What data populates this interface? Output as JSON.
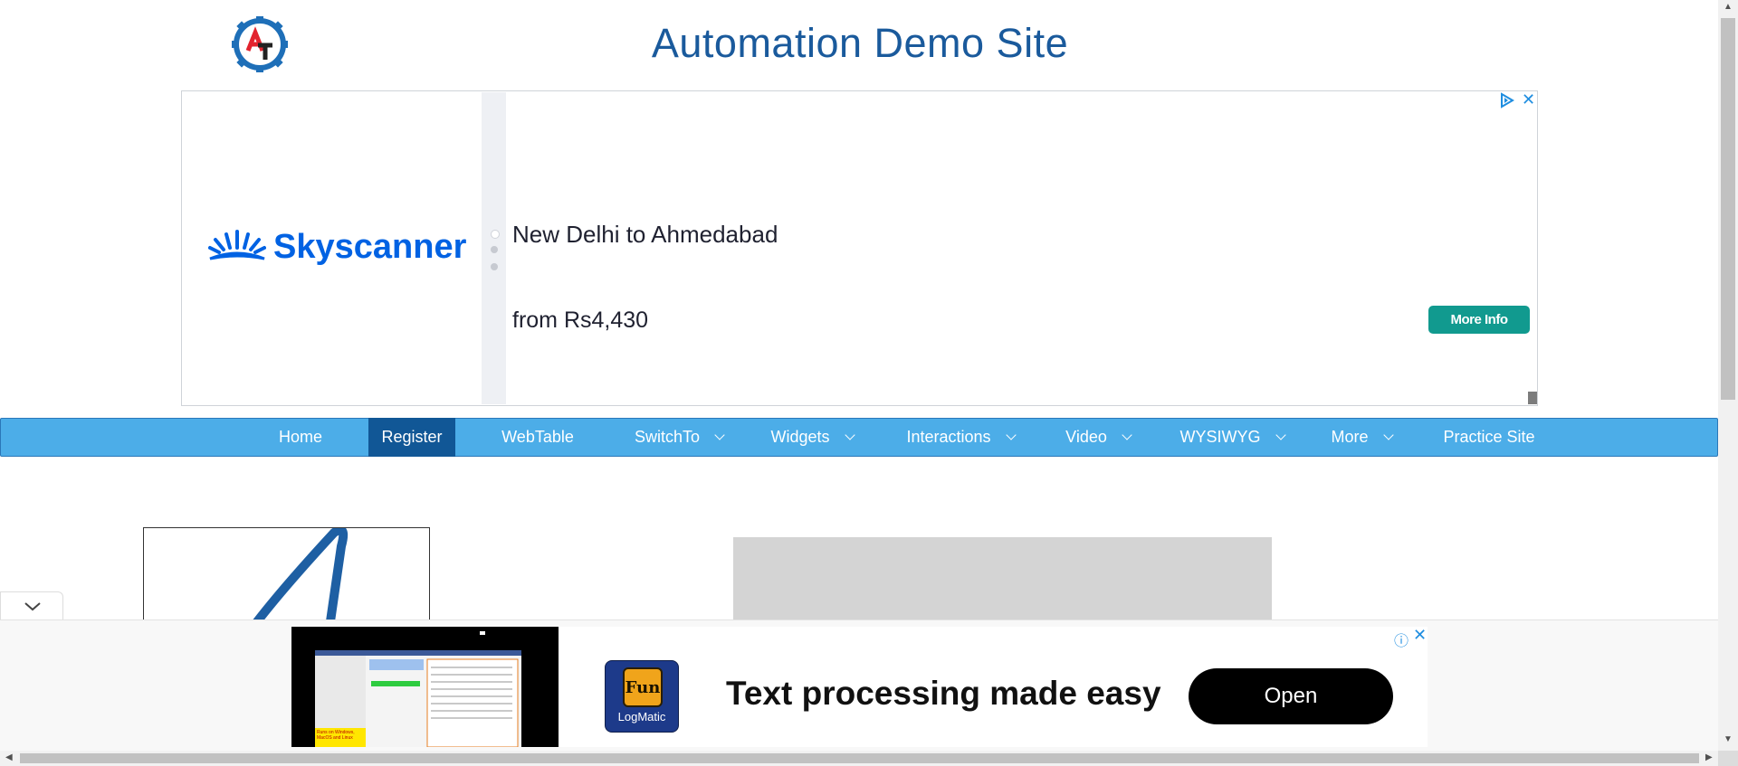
{
  "header": {
    "logo_text": "AT",
    "title": "Automation Demo Site"
  },
  "top_ad": {
    "brand": "Skyscanner",
    "headline": "New Delhi to Ahmedabad",
    "price": "from Rs4,430",
    "cta": "More Info",
    "close_icon": "close-icon",
    "adchoice_icon": "adchoices-icon"
  },
  "nav": {
    "items": [
      {
        "label": "Home",
        "dropdown": false,
        "active": false
      },
      {
        "label": "Register",
        "dropdown": false,
        "active": true
      },
      {
        "label": "WebTable",
        "dropdown": false,
        "active": false
      },
      {
        "label": "SwitchTo",
        "dropdown": true,
        "active": false
      },
      {
        "label": "Widgets",
        "dropdown": true,
        "active": false
      },
      {
        "label": "Interactions",
        "dropdown": true,
        "active": false
      },
      {
        "label": "Video",
        "dropdown": true,
        "active": false
      },
      {
        "label": "WYSIWYG",
        "dropdown": true,
        "active": false
      },
      {
        "label": "More",
        "dropdown": true,
        "active": false
      },
      {
        "label": "Practice Site",
        "dropdown": false,
        "active": false
      }
    ],
    "bg_color": "#4cade8",
    "active_color": "#115796"
  },
  "bottom_ad": {
    "app_icon_text": "Fun",
    "app_name": "LogMatic",
    "headline": "Text processing made easy",
    "cta": "Open",
    "thumb_caption": "Runs on Windows, MacOS and Linux"
  },
  "colors": {
    "title_blue": "#1a5a9c",
    "skyscanner_blue": "#0062e3",
    "more_info_teal": "#119a8f"
  }
}
